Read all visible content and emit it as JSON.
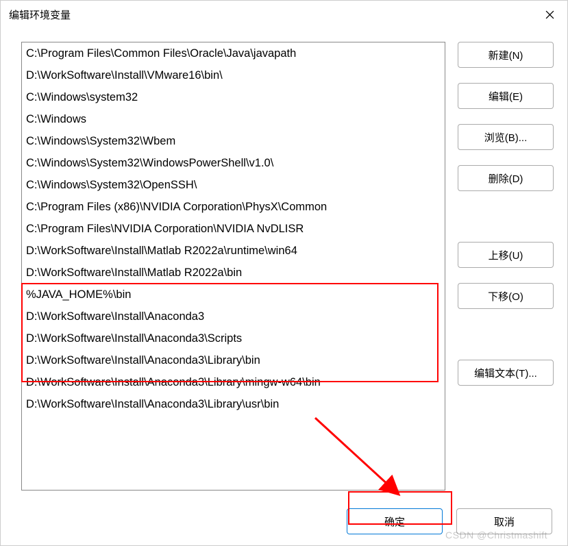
{
  "title": "编辑环境变量",
  "path_entries": [
    "C:\\Program Files\\Common Files\\Oracle\\Java\\javapath",
    "D:\\WorkSoftware\\Install\\VMware16\\bin\\",
    "C:\\Windows\\system32",
    "C:\\Windows",
    "C:\\Windows\\System32\\Wbem",
    "C:\\Windows\\System32\\WindowsPowerShell\\v1.0\\",
    "C:\\Windows\\System32\\OpenSSH\\",
    "C:\\Program Files (x86)\\NVIDIA Corporation\\PhysX\\Common",
    "C:\\Program Files\\NVIDIA Corporation\\NVIDIA NvDLISR",
    "D:\\WorkSoftware\\Install\\Matlab R2022a\\runtime\\win64",
    "D:\\WorkSoftware\\Install\\Matlab R2022a\\bin",
    "%JAVA_HOME%\\bin",
    "D:\\WorkSoftware\\Install\\Anaconda3",
    "D:\\WorkSoftware\\Install\\Anaconda3\\Scripts",
    "D:\\WorkSoftware\\Install\\Anaconda3\\Library\\bin",
    "D:\\WorkSoftware\\Install\\Anaconda3\\Library\\mingw-w64\\bin",
    "D:\\WorkSoftware\\Install\\Anaconda3\\Library\\usr\\bin"
  ],
  "buttons": {
    "new": "新建(N)",
    "edit": "编辑(E)",
    "browse": "浏览(B)...",
    "delete": "删除(D)",
    "move_up": "上移(U)",
    "move_down": "下移(O)",
    "edit_text": "编辑文本(T)...",
    "ok": "确定",
    "cancel": "取消"
  },
  "watermark": "CSDN @Christmashift"
}
